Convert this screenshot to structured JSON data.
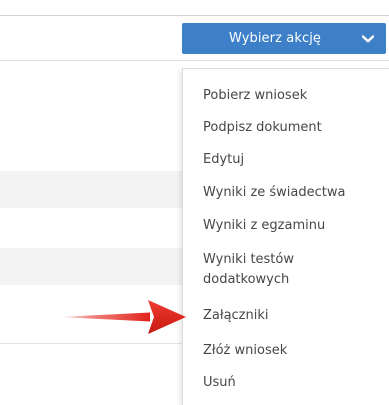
{
  "action_button": {
    "label": "Wybierz akcję",
    "color": "#3d80c8"
  },
  "menu": {
    "items": [
      {
        "label": "Pobierz wniosek"
      },
      {
        "label": "Podpisz dokument"
      },
      {
        "label": "Edytuj"
      },
      {
        "label": "Wyniki ze świadectwa"
      },
      {
        "label": "Wyniki z egzaminu"
      },
      {
        "label": "Wyniki testów dodatkowych"
      },
      {
        "label": "Załączniki"
      },
      {
        "label": "Złóż wniosek"
      },
      {
        "label": "Usuń"
      }
    ]
  },
  "annotation": {
    "icon": "red-arrow-icon",
    "color": "#e2231a"
  }
}
